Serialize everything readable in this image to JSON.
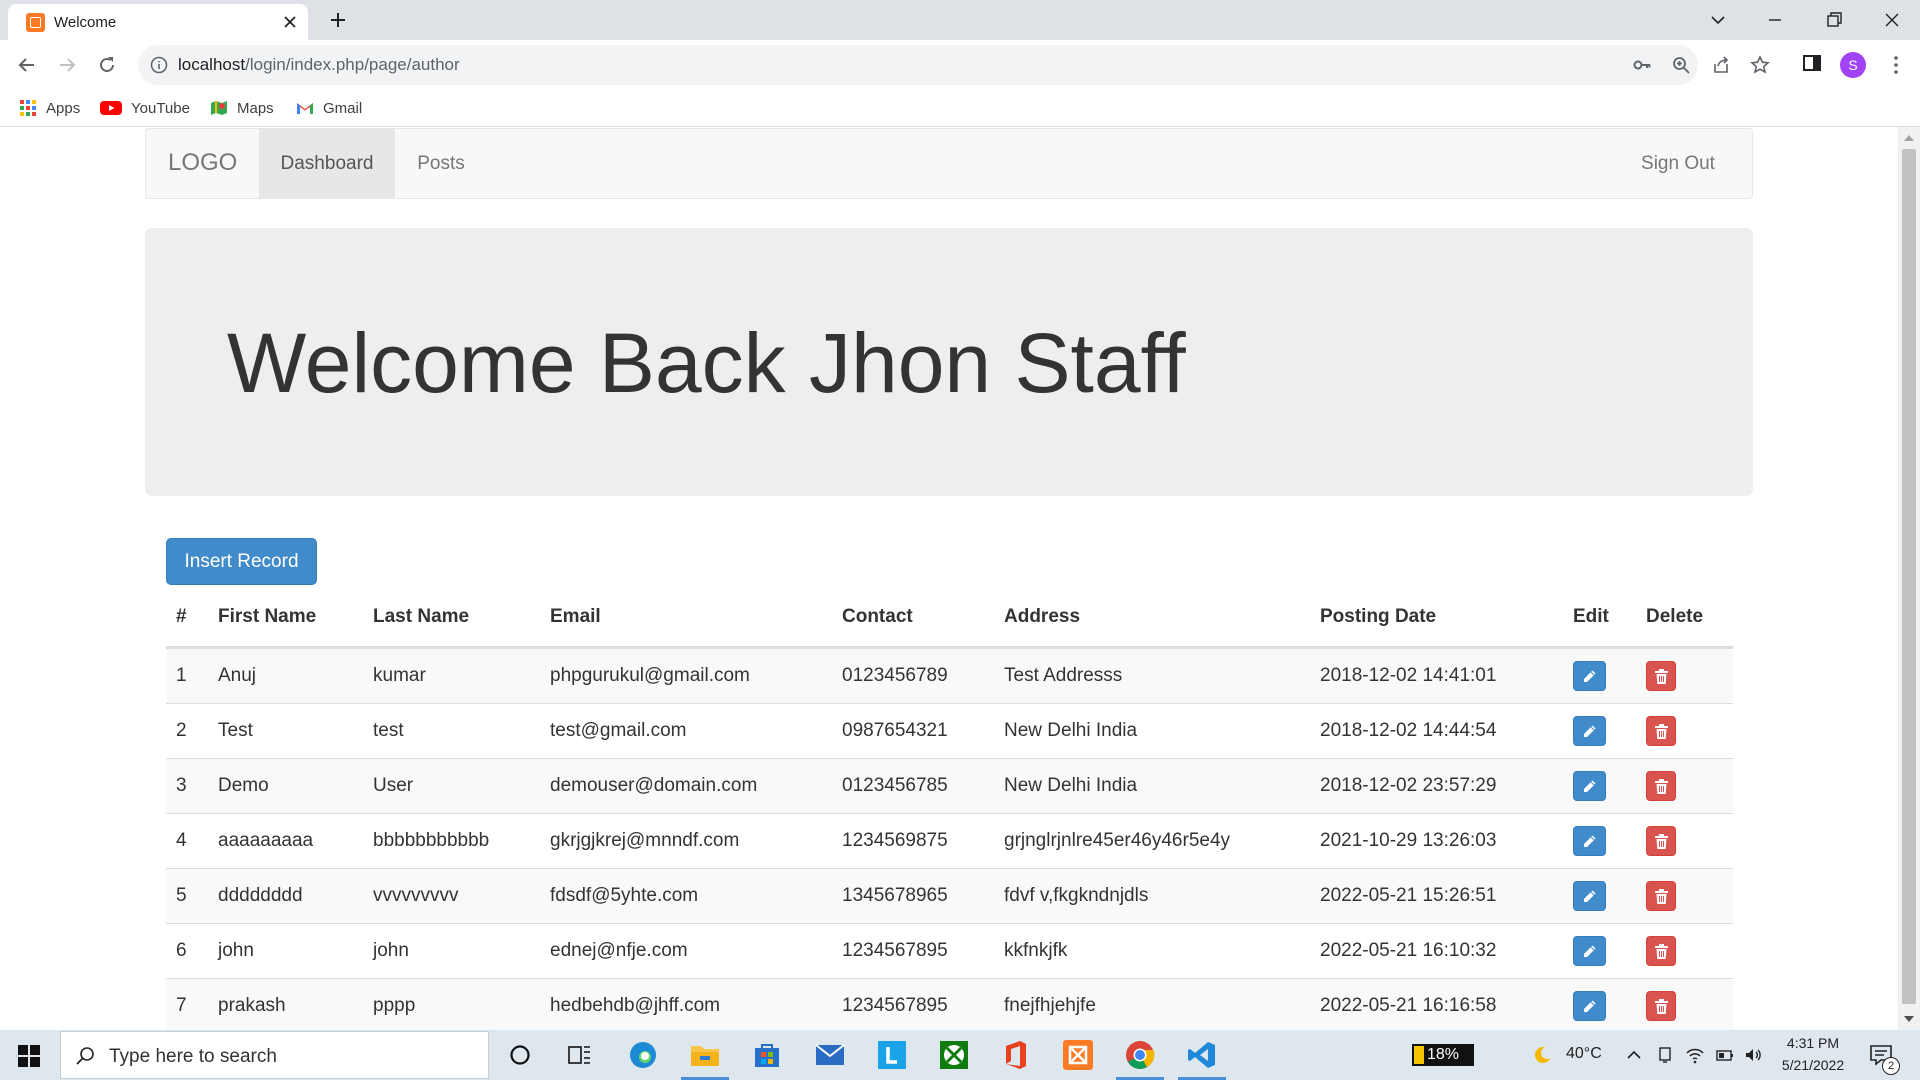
{
  "browser": {
    "tab_title": "Welcome",
    "url_host": "localhost",
    "url_path": "/login/index.php/page/author",
    "profile_initial": "S",
    "bookmarks": [
      "Apps",
      "YouTube",
      "Maps",
      "Gmail"
    ]
  },
  "nav": {
    "logo": "LOGO",
    "dashboard": "Dashboard",
    "posts": "Posts",
    "signout": "Sign Out"
  },
  "jumbotron": {
    "welcome": "Welcome Back Jhon Staff"
  },
  "insert_button": "Insert Record",
  "table": {
    "headers": [
      "#",
      "First Name",
      "Last Name",
      "Email",
      "Contact",
      "Address",
      "Posting Date",
      "Edit",
      "Delete"
    ],
    "rows": [
      {
        "num": "1",
        "first": "Anuj",
        "last": "kumar",
        "email": "phpgurukul@gmail.com",
        "contact": "0123456789",
        "address": "Test Addresss",
        "date": "2018-12-02 14:41:01"
      },
      {
        "num": "2",
        "first": "Test",
        "last": "test",
        "email": "test@gmail.com",
        "contact": "0987654321",
        "address": "New Delhi India",
        "date": "2018-12-02 14:44:54"
      },
      {
        "num": "3",
        "first": "Demo",
        "last": "User",
        "email": "demouser@domain.com",
        "contact": "0123456785",
        "address": "New Delhi India",
        "date": "2018-12-02 23:57:29"
      },
      {
        "num": "4",
        "first": "aaaaaaaaa",
        "last": "bbbbbbbbbbb",
        "email": "gkrjgjkrej@mnndf.com",
        "contact": "1234569875",
        "address": "grjnglrjnlre45er46y46r5e4y",
        "date": "2021-10-29 13:26:03"
      },
      {
        "num": "5",
        "first": "dddddddd",
        "last": "vvvvvvvvv",
        "email": "fdsdf@5yhte.com",
        "contact": "1345678965",
        "address": "fdvf v,fkgkndnjdls",
        "date": "2022-05-21 15:26:51"
      },
      {
        "num": "6",
        "first": "john",
        "last": "john",
        "email": "ednej@nfje.com",
        "contact": "1234567895",
        "address": "kkfnkjfk",
        "date": "2022-05-21 16:10:32"
      },
      {
        "num": "7",
        "first": "prakash",
        "last": "pppp",
        "email": "hedbehdb@jhff.com",
        "contact": "1234567895",
        "address": "fnejfhjehjfe",
        "date": "2022-05-21 16:16:58"
      }
    ]
  },
  "taskbar": {
    "search_placeholder": "Type here to search",
    "battery": "18%",
    "temperature": "40°C",
    "time": "4:31 PM",
    "date": "5/21/2022",
    "notification_count": "2"
  },
  "colors": {
    "primary": "#428bca",
    "danger": "#d9534f",
    "jumbotron_bg": "#eeeeee",
    "navbar_bg": "#f8f8f8"
  }
}
